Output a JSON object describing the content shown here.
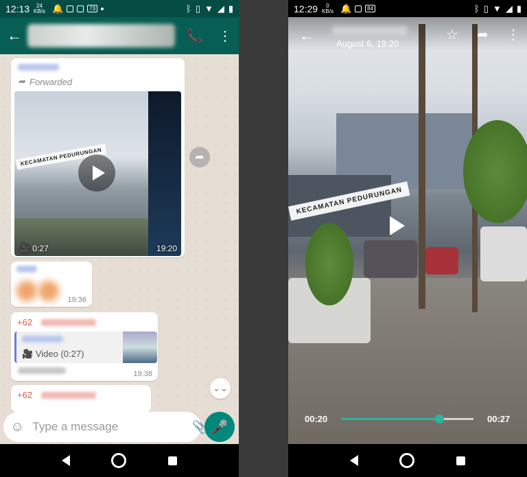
{
  "left": {
    "status": {
      "time": "12:13",
      "kb_value": "24",
      "kb_unit": "KB/s",
      "badge": "73"
    },
    "header": {
      "title": "",
      "add_call_icon": "add-call-icon"
    },
    "messages": {
      "forwarded_label": "Forwarded",
      "video_stamp": "KECAMATAN PEDURUNGAN",
      "video_duration": "0:27",
      "video_time": "19:20",
      "msg2_time": "19:36",
      "msg3_sender": "+62",
      "msg3_quote_label": "Video (0:27)",
      "msg3_time": "19:38",
      "msg4_sender": "+62"
    },
    "composer": {
      "placeholder": "Type a message"
    }
  },
  "right": {
    "status": {
      "time": "12:29",
      "kb_value": "0",
      "kb_unit": "KB/s",
      "badge": "84"
    },
    "viewer": {
      "date": "August 6, 19:20",
      "stamp": "KECAMATAN PEDURUNGAN",
      "current_time": "00:20",
      "total_time": "00:27",
      "progress": 0.74
    }
  },
  "colors": {
    "header": "#075e54",
    "accent": "#00897b",
    "seek": "#2bb5a0",
    "sender": "#e0584c"
  }
}
